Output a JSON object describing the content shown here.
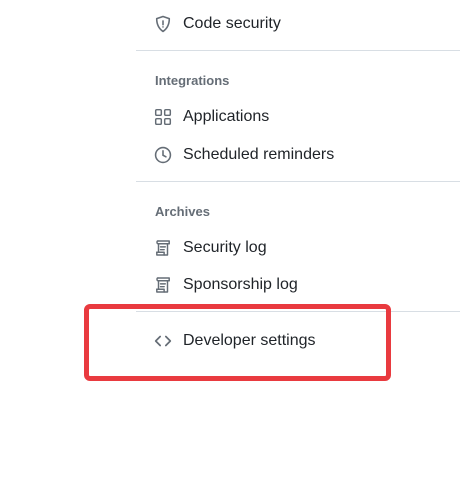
{
  "nav": {
    "code_security": {
      "label": "Code security",
      "icon": "shield-icon"
    },
    "integrations": {
      "heading": "Integrations",
      "items": [
        {
          "label": "Applications",
          "icon": "apps-grid-icon"
        },
        {
          "label": "Scheduled reminders",
          "icon": "clock-icon"
        }
      ]
    },
    "archives": {
      "heading": "Archives",
      "items": [
        {
          "label": "Security log",
          "icon": "log-icon"
        },
        {
          "label": "Sponsorship log",
          "icon": "log-icon"
        }
      ]
    },
    "developer_settings": {
      "label": "Developer settings",
      "icon": "code-icon"
    }
  },
  "colors": {
    "highlight": "#e93a3f",
    "divider": "#d8dee4",
    "heading": "#656d76",
    "text": "#1f2328"
  }
}
